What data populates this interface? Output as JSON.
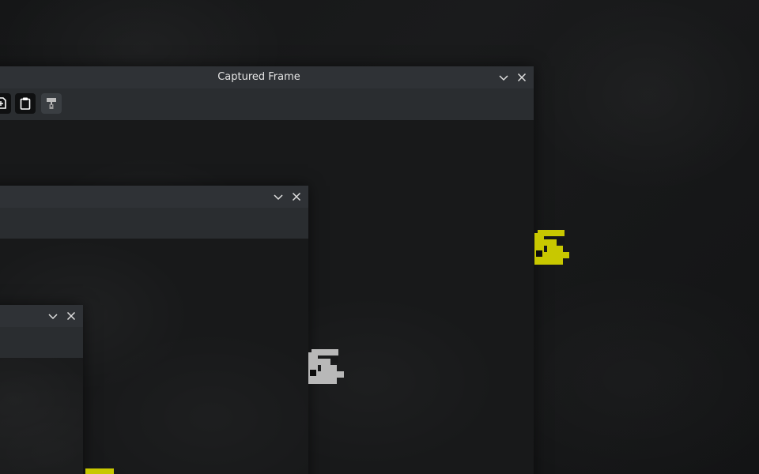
{
  "main_window": {
    "title": "Captured Frame",
    "toolbar": {
      "tools": [
        {
          "name": "save-icon"
        },
        {
          "name": "clipboard-icon"
        },
        {
          "name": "paint-brush-icon"
        }
      ]
    }
  },
  "colors": {
    "titlebar": "#2f3236",
    "toolbar": "#2a2d30",
    "desktop": "#141516",
    "window_body": "#18191a",
    "sprite_yellow": "#c8c800",
    "sprite_gray": "#b8b8b8"
  },
  "icons": {
    "minimize": "chevron-down-icon",
    "close": "close-icon"
  }
}
